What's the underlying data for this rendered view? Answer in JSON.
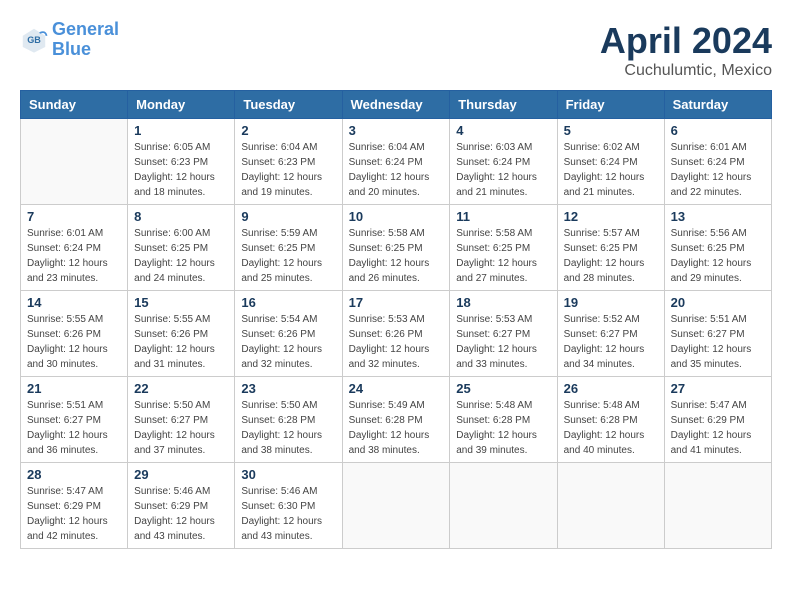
{
  "header": {
    "logo_line1": "General",
    "logo_line2": "Blue",
    "month": "April 2024",
    "location": "Cuchulumtic, Mexico"
  },
  "columns": [
    "Sunday",
    "Monday",
    "Tuesday",
    "Wednesday",
    "Thursday",
    "Friday",
    "Saturday"
  ],
  "weeks": [
    [
      {
        "day": "",
        "info": ""
      },
      {
        "day": "1",
        "info": "Sunrise: 6:05 AM\nSunset: 6:23 PM\nDaylight: 12 hours\nand 18 minutes."
      },
      {
        "day": "2",
        "info": "Sunrise: 6:04 AM\nSunset: 6:23 PM\nDaylight: 12 hours\nand 19 minutes."
      },
      {
        "day": "3",
        "info": "Sunrise: 6:04 AM\nSunset: 6:24 PM\nDaylight: 12 hours\nand 20 minutes."
      },
      {
        "day": "4",
        "info": "Sunrise: 6:03 AM\nSunset: 6:24 PM\nDaylight: 12 hours\nand 21 minutes."
      },
      {
        "day": "5",
        "info": "Sunrise: 6:02 AM\nSunset: 6:24 PM\nDaylight: 12 hours\nand 21 minutes."
      },
      {
        "day": "6",
        "info": "Sunrise: 6:01 AM\nSunset: 6:24 PM\nDaylight: 12 hours\nand 22 minutes."
      }
    ],
    [
      {
        "day": "7",
        "info": "Sunrise: 6:01 AM\nSunset: 6:24 PM\nDaylight: 12 hours\nand 23 minutes."
      },
      {
        "day": "8",
        "info": "Sunrise: 6:00 AM\nSunset: 6:25 PM\nDaylight: 12 hours\nand 24 minutes."
      },
      {
        "day": "9",
        "info": "Sunrise: 5:59 AM\nSunset: 6:25 PM\nDaylight: 12 hours\nand 25 minutes."
      },
      {
        "day": "10",
        "info": "Sunrise: 5:58 AM\nSunset: 6:25 PM\nDaylight: 12 hours\nand 26 minutes."
      },
      {
        "day": "11",
        "info": "Sunrise: 5:58 AM\nSunset: 6:25 PM\nDaylight: 12 hours\nand 27 minutes."
      },
      {
        "day": "12",
        "info": "Sunrise: 5:57 AM\nSunset: 6:25 PM\nDaylight: 12 hours\nand 28 minutes."
      },
      {
        "day": "13",
        "info": "Sunrise: 5:56 AM\nSunset: 6:25 PM\nDaylight: 12 hours\nand 29 minutes."
      }
    ],
    [
      {
        "day": "14",
        "info": "Sunrise: 5:55 AM\nSunset: 6:26 PM\nDaylight: 12 hours\nand 30 minutes."
      },
      {
        "day": "15",
        "info": "Sunrise: 5:55 AM\nSunset: 6:26 PM\nDaylight: 12 hours\nand 31 minutes."
      },
      {
        "day": "16",
        "info": "Sunrise: 5:54 AM\nSunset: 6:26 PM\nDaylight: 12 hours\nand 32 minutes."
      },
      {
        "day": "17",
        "info": "Sunrise: 5:53 AM\nSunset: 6:26 PM\nDaylight: 12 hours\nand 32 minutes."
      },
      {
        "day": "18",
        "info": "Sunrise: 5:53 AM\nSunset: 6:27 PM\nDaylight: 12 hours\nand 33 minutes."
      },
      {
        "day": "19",
        "info": "Sunrise: 5:52 AM\nSunset: 6:27 PM\nDaylight: 12 hours\nand 34 minutes."
      },
      {
        "day": "20",
        "info": "Sunrise: 5:51 AM\nSunset: 6:27 PM\nDaylight: 12 hours\nand 35 minutes."
      }
    ],
    [
      {
        "day": "21",
        "info": "Sunrise: 5:51 AM\nSunset: 6:27 PM\nDaylight: 12 hours\nand 36 minutes."
      },
      {
        "day": "22",
        "info": "Sunrise: 5:50 AM\nSunset: 6:27 PM\nDaylight: 12 hours\nand 37 minutes."
      },
      {
        "day": "23",
        "info": "Sunrise: 5:50 AM\nSunset: 6:28 PM\nDaylight: 12 hours\nand 38 minutes."
      },
      {
        "day": "24",
        "info": "Sunrise: 5:49 AM\nSunset: 6:28 PM\nDaylight: 12 hours\nand 38 minutes."
      },
      {
        "day": "25",
        "info": "Sunrise: 5:48 AM\nSunset: 6:28 PM\nDaylight: 12 hours\nand 39 minutes."
      },
      {
        "day": "26",
        "info": "Sunrise: 5:48 AM\nSunset: 6:28 PM\nDaylight: 12 hours\nand 40 minutes."
      },
      {
        "day": "27",
        "info": "Sunrise: 5:47 AM\nSunset: 6:29 PM\nDaylight: 12 hours\nand 41 minutes."
      }
    ],
    [
      {
        "day": "28",
        "info": "Sunrise: 5:47 AM\nSunset: 6:29 PM\nDaylight: 12 hours\nand 42 minutes."
      },
      {
        "day": "29",
        "info": "Sunrise: 5:46 AM\nSunset: 6:29 PM\nDaylight: 12 hours\nand 43 minutes."
      },
      {
        "day": "30",
        "info": "Sunrise: 5:46 AM\nSunset: 6:30 PM\nDaylight: 12 hours\nand 43 minutes."
      },
      {
        "day": "",
        "info": ""
      },
      {
        "day": "",
        "info": ""
      },
      {
        "day": "",
        "info": ""
      },
      {
        "day": "",
        "info": ""
      }
    ]
  ]
}
